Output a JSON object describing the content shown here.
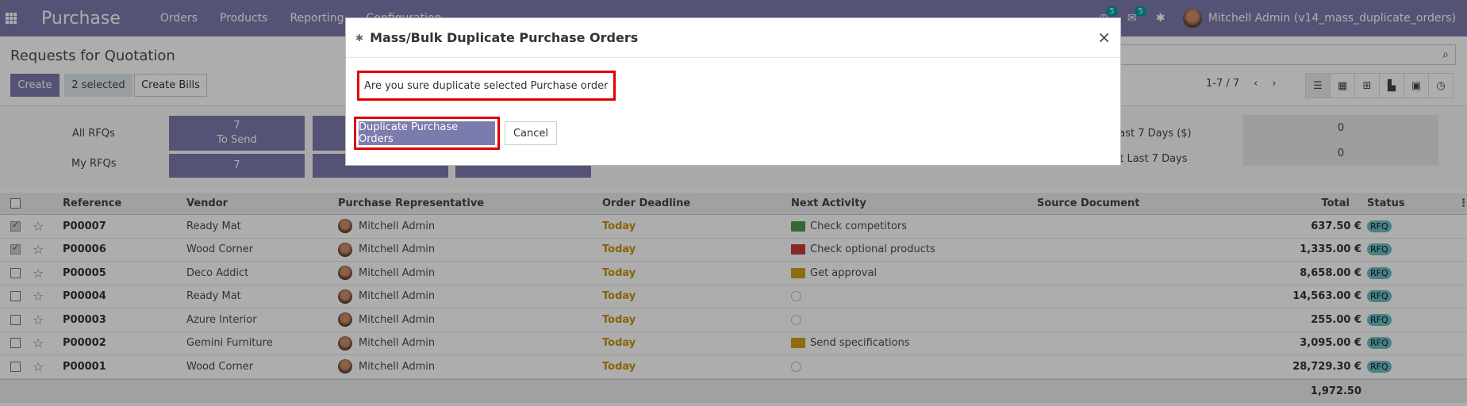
{
  "navbar": {
    "brand": "Purchase",
    "menu": [
      "Orders",
      "Products",
      "Reporting",
      "Configuration"
    ],
    "chat_badge": "5",
    "activity_badge": "5",
    "user_name": "Mitchell Admin (v14_mass_duplicate_orders)"
  },
  "control_panel": {
    "title": "Requests for Quotation",
    "create_label": "Create",
    "selected_label": "2 selected",
    "create_bills_label": "Create Bills",
    "pager": "1-7 / 7"
  },
  "dashboard": {
    "all_rfqs_label": "All RFQs",
    "my_rfqs_label": "My RFQs",
    "tile_to_send_count": "7",
    "tile_to_send_label": "To Send",
    "tile_my_count": "7",
    "stat1_label": "Last 7 Days ($)",
    "stat1_value": "0",
    "stat2_label": "nt Last 7 Days",
    "stat2_value": "0"
  },
  "table": {
    "headers": {
      "reference": "Reference",
      "vendor": "Vendor",
      "rep": "Purchase Representative",
      "deadline": "Order Deadline",
      "activity": "Next Activity",
      "source": "Source Document",
      "total": "Total",
      "status": "Status"
    },
    "rows": [
      {
        "ref": "P00007",
        "vendor": "Ready Mat",
        "rep": "Mitchell Admin",
        "deadline": "Today",
        "activity": "Check competitors",
        "activity_color": "#4c9a4c",
        "total": "637.50 €",
        "status": "RFQ",
        "checked": true
      },
      {
        "ref": "P00006",
        "vendor": "Wood Corner",
        "rep": "Mitchell Admin",
        "deadline": "Today",
        "activity": "Check optional products",
        "activity_color": "#c93b3b",
        "total": "1,335.00 €",
        "status": "RFQ",
        "checked": true
      },
      {
        "ref": "P00005",
        "vendor": "Deco Addict",
        "rep": "Mitchell Admin",
        "deadline": "Today",
        "activity": "Get approval",
        "activity_color": "#d2a01a",
        "total": "8,658.00 €",
        "status": "RFQ",
        "checked": false
      },
      {
        "ref": "P00004",
        "vendor": "Ready Mat",
        "rep": "Mitchell Admin",
        "deadline": "Today",
        "activity": "",
        "activity_color": "",
        "total": "14,563.00 €",
        "status": "RFQ",
        "checked": false
      },
      {
        "ref": "P00003",
        "vendor": "Azure Interior",
        "rep": "Mitchell Admin",
        "deadline": "Today",
        "activity": "",
        "activity_color": "",
        "total": "255.00 €",
        "status": "RFQ",
        "checked": false
      },
      {
        "ref": "P00002",
        "vendor": "Gemini Furniture",
        "rep": "Mitchell Admin",
        "deadline": "Today",
        "activity": "Send specifications",
        "activity_color": "#d2a01a",
        "total": "3,095.00 €",
        "status": "RFQ",
        "checked": false
      },
      {
        "ref": "P00001",
        "vendor": "Wood Corner",
        "rep": "Mitchell Admin",
        "deadline": "Today",
        "activity": "",
        "activity_color": "",
        "total": "28,729.30 €",
        "status": "RFQ",
        "checked": false
      }
    ],
    "footer_total": "1,972.50"
  },
  "modal": {
    "title": "Mass/Bulk Duplicate Purchase Orders",
    "message": "Are you sure duplicate selected Purchase order",
    "primary_label": "Duplicate Purchase Orders",
    "cancel_label": "Cancel",
    "close_glyph": "×"
  },
  "colors": {
    "brand": "#7c7bad",
    "highlight": "#e00000",
    "deadline": "#c8930b",
    "status_badge": "#6cc1bd"
  }
}
